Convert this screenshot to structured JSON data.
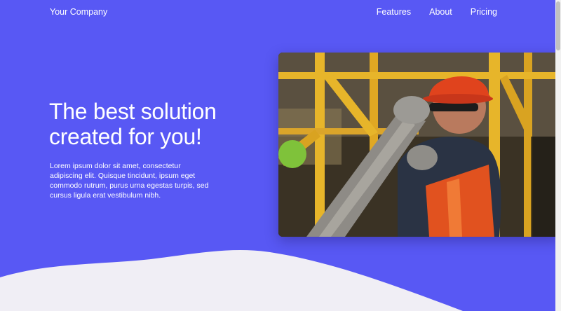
{
  "brand": {
    "name": "Your Company"
  },
  "nav": {
    "items": [
      {
        "label": "Features"
      },
      {
        "label": "About"
      },
      {
        "label": "Pricing"
      }
    ]
  },
  "hero": {
    "title": "The best solution created for you!",
    "description": "Lorem ipsum dolor sit amet, consectetur adipiscing elit. Quisque tincidunt, ipsum eget commodo rutrum, purus urna egestas turpis, sed cursus ligula erat vestibulum nibh.",
    "image_subject": "construction worker in orange hard hat carrying a concrete pump hose"
  },
  "colors": {
    "background": "#5858f4",
    "wave": "#f0eef5",
    "text": "#ffffff",
    "hard_hat": "#e0431d",
    "scaffold": "#e7b52a"
  }
}
